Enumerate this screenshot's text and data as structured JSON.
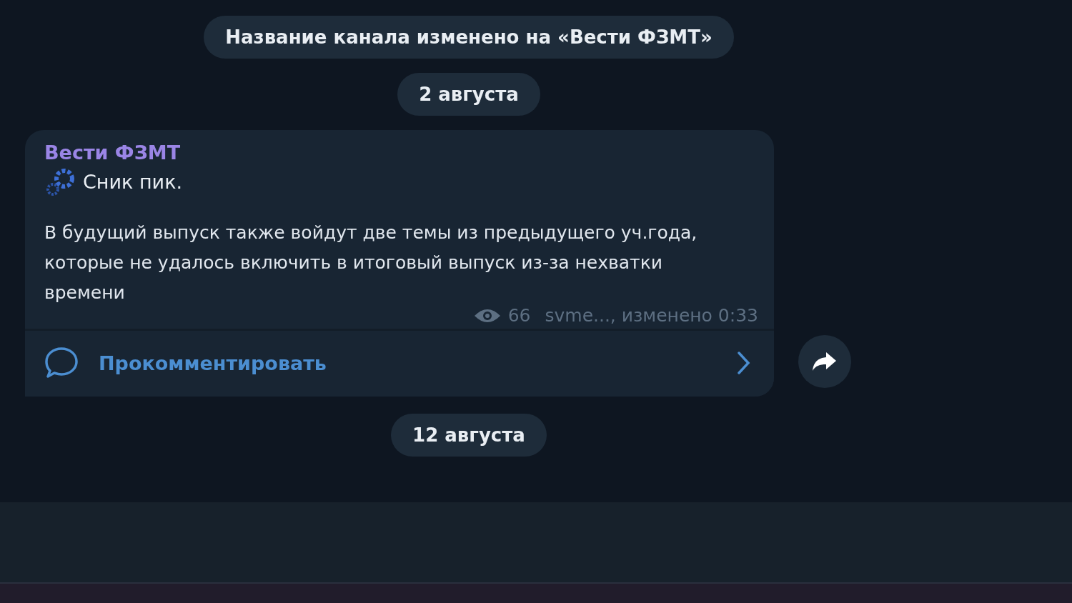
{
  "feed": [
    {
      "kind": "service",
      "text": "Название канала изменено на «Вести ФЗМТ»"
    },
    {
      "kind": "date",
      "text": "2 августа"
    },
    {
      "kind": "post",
      "author": "Вести ФЗМТ",
      "headline": "Сник пик.",
      "body": "В будущий выпуск также войдут две темы из предыдущего уч.года, которые не удалось включить в итоговый выпуск из-за нехватки времени",
      "views": "66",
      "signature": "svme..., изменено 0:33",
      "comment_label": "Прокомментировать"
    },
    {
      "kind": "date",
      "text": "12 августа"
    }
  ]
}
